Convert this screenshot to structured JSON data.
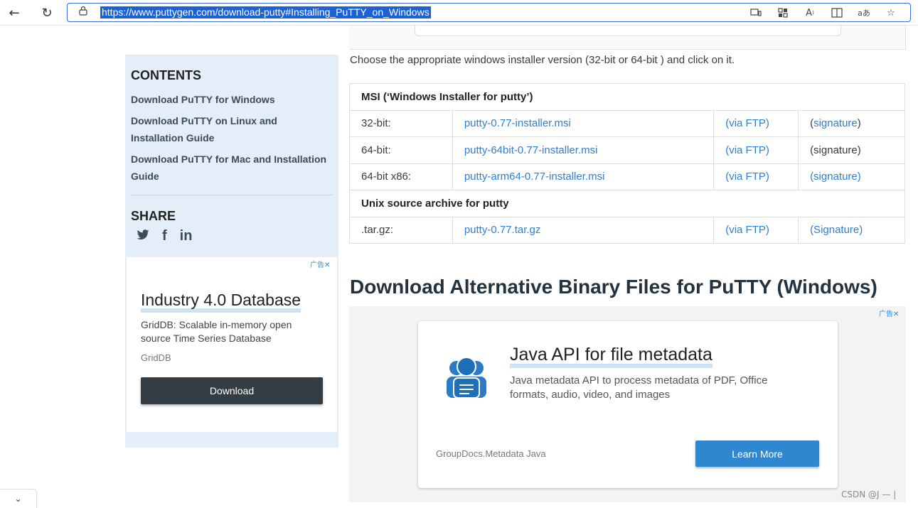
{
  "browser": {
    "url": "https://www.puttygen.com/download-putty#Installing_PuTTY_on_Windows",
    "back_icon": "←",
    "refresh_icon": "↻",
    "lock_icon": "🔒"
  },
  "sidebar": {
    "contents_title": "CONTENTS",
    "items": [
      {
        "label": "Download PuTTY for Windows"
      },
      {
        "label": "Download PuTTY on Linux and Installation Guide"
      },
      {
        "label": "Download PuTTY for Mac and Installation Guide"
      }
    ],
    "share_title": "SHARE",
    "share_icons": {
      "twitter": "🐦",
      "facebook": "f",
      "linkedin": "in"
    }
  },
  "side_ad": {
    "mark": "广告✕",
    "headline": "Industry 4.0 Database",
    "description": "GridDB: Scalable in-memory open source Time Series Database",
    "brand": "GridDB",
    "button": "Download"
  },
  "main": {
    "intro": "Choose the appropriate windows installer version (32-bit or 64-bit ) and click on it.",
    "table": {
      "msi_header": "MSI (‘Windows Installer for putty’)",
      "rows": [
        {
          "arch": "32-bit:",
          "file": "putty-0.77-installer.msi",
          "ftp": "(via FTP)",
          "sig_open": "(",
          "sig": "signature",
          "sig_close": ")"
        },
        {
          "arch": "64-bit:",
          "file": "putty-64bit-0.77-installer.msi",
          "ftp": "(via FTP)",
          "sig_open": "",
          "sig": "(signature)",
          "sig_close": ""
        },
        {
          "arch": "64-bit x86:",
          "file": "putty-arm64-0.77-installer.msi",
          "ftp": "(via FTP)",
          "sig_open": "",
          "sig": "(signature)",
          "sig_close": ""
        }
      ],
      "unix_header": "Unix source archive for putty",
      "unix_row": {
        "arch": ".tar.gz:",
        "file": "putty-0.77.tar.gz",
        "ftp": "(via FTP)",
        "sig": "(Signature)"
      }
    },
    "alt_title": "Download Alternative Binary Files for PuTTY (Windows)"
  },
  "main_ad": {
    "mark": "广告✕",
    "headline": "Java API for file metadata",
    "description": "Java metadata API to process metadata of PDF, Office formats, audio, video, and images",
    "brand": "GroupDocs.Metadata Java",
    "button": "Learn More"
  },
  "watermark": "CSDN @J — |",
  "bottom_chevron": "⌄"
}
